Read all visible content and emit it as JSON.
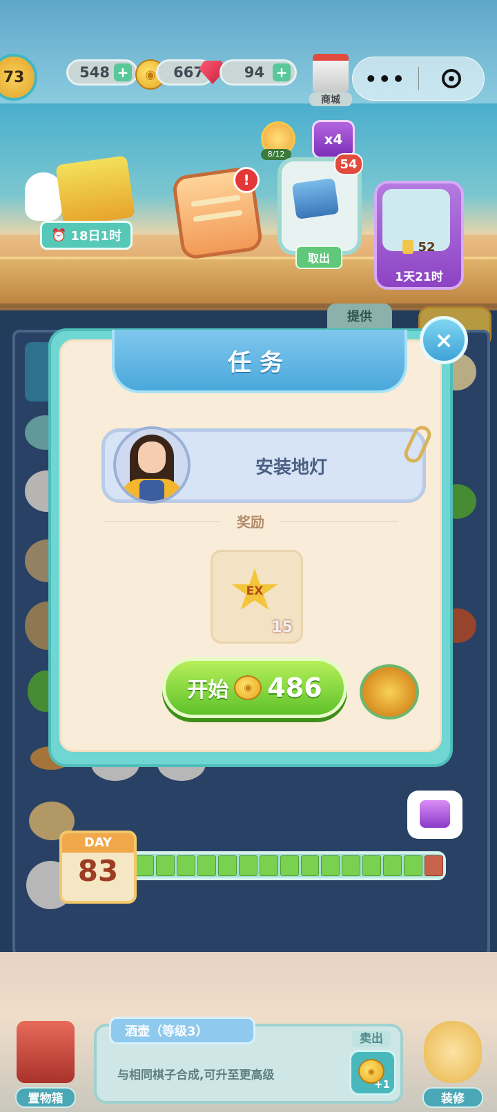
{
  "header": {
    "level": "73",
    "energy": "548",
    "coins": "667",
    "gems": "94",
    "shop_label": "商城",
    "capsule_more": "•••"
  },
  "events": {
    "gift_timer": "18日1时",
    "flower_count": "8/12",
    "multiplier": "x4",
    "chest_count": "54",
    "take_out_label": "取出",
    "event_tickets": "52",
    "event_timer": "1天21时",
    "supply_label": "提供"
  },
  "modal": {
    "title": "任务",
    "close_symbol": "×",
    "task_name": "安装地灯",
    "reward_label": "奖励",
    "reward_icon_text": "EX",
    "reward_qty": "15",
    "start_label": "开始",
    "start_cost": "486"
  },
  "progress": {
    "day_label": "DAY",
    "day_number": "83",
    "filled_segments": 14,
    "total_segments": 15
  },
  "bottom": {
    "storage_label": "置物箱",
    "item_title": "酒壶（等级3）",
    "item_description": "与相同棋子合成,可升至更高级",
    "sell_label": "卖出",
    "sell_value": "+1",
    "decorate_label": "装修"
  }
}
